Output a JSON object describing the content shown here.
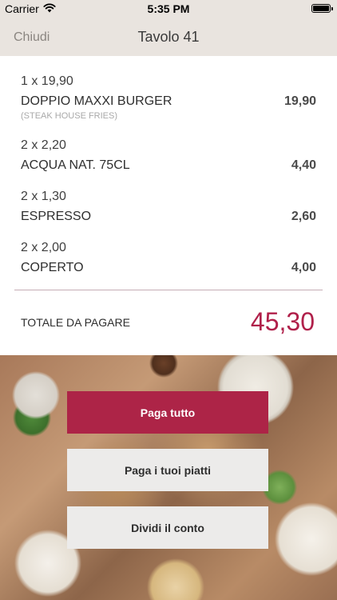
{
  "status_bar": {
    "carrier": "Carrier",
    "time": "5:35 PM",
    "battery_level": 1.0
  },
  "nav": {
    "back_label": "Chiudi",
    "title": "Tavolo 41"
  },
  "order": {
    "items": [
      {
        "quantity_line": "1 x 19,90",
        "name": "DOPPIO MAXXI BURGER",
        "note": "(STEAK HOUSE FRIES)",
        "price": "19,90"
      },
      {
        "quantity_line": "2 x 2,20",
        "name": "ACQUA NAT. 75CL",
        "note": "",
        "price": "4,40"
      },
      {
        "quantity_line": "2 x 1,30",
        "name": "ESPRESSO",
        "note": "",
        "price": "2,60"
      },
      {
        "quantity_line": "2 x 2,00",
        "name": "COPERTO",
        "note": "",
        "price": "4,00"
      }
    ],
    "total_label": "TOTALE DA PAGARE",
    "total_value": "45,30"
  },
  "actions": {
    "pay_all": "Paga tutto",
    "pay_own_items": "Paga i tuoi piatti",
    "split_bill": "Dividi il conto"
  },
  "colors": {
    "accent": "#ad2447",
    "total": "#b0204a",
    "nav_background": "#e9e4df"
  }
}
